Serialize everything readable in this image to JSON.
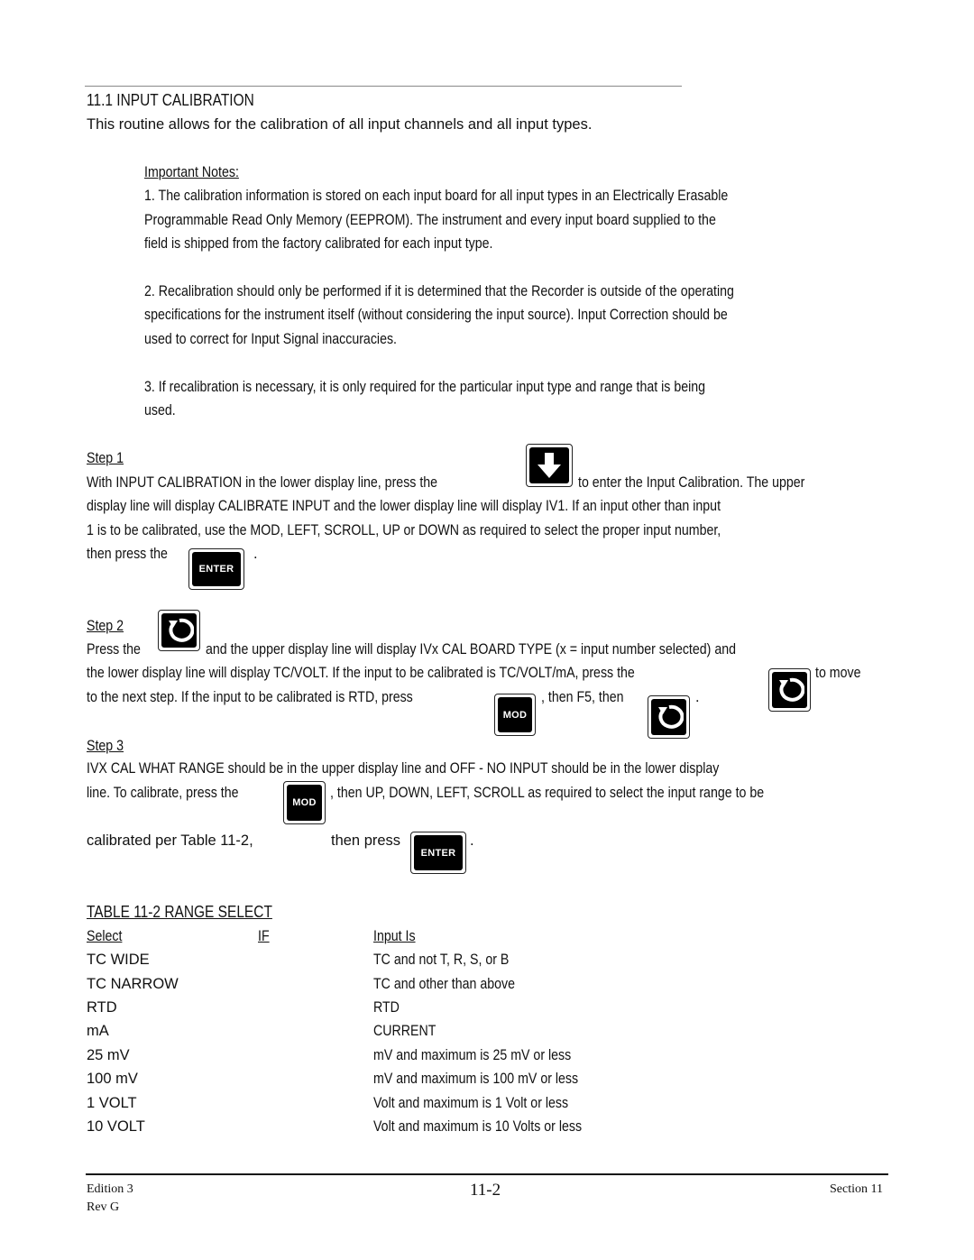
{
  "section": {
    "heading": "11.1  INPUT CALIBRATION",
    "intro": "This routine allows for the calibration of all input channels and all input types."
  },
  "notes": {
    "title": "Important Notes: ",
    "note1": [
      "1.  The calibration information is stored on each input board for all input types in an Electrically Erasable",
      "Programmable Read Only Memory (EEPROM).  The instrument and every input board supplied to the",
      "field is shipped from the factory calibrated for each input type."
    ],
    "note2": [
      "2.  Recalibration should only be performed if it is determined that the Recorder is outside of the operating",
      "specifications for the instrument itself (without considering the input source).  Input Correction should be",
      "used to correct for Input Signal inaccuracies."
    ],
    "note3": [
      "3.  If recalibration is necessary, it is only required for the particular input type and range that is being",
      "used."
    ]
  },
  "step1": {
    "title": "Step 1",
    "line1_before": "With INPUT CALIBRATION  in the lower display line, press the",
    "line1_after": "to enter the Input Calibration.  The upper",
    "line2": "display line will display CALIBRATE INPUT  and the lower display line will display IV1.  If an input other than input",
    "line3": "1 is to be calibrated, use the MOD, LEFT, SCROLL, UP or DOWN as required to select the proper input number,",
    "line4_before": "then press the",
    "line4_after": "."
  },
  "step2": {
    "title": "Step 2",
    "line1_before": "Press the",
    "line1_after": "and the upper display line will display IVx CAL BOARD TYPE  (x = input number selected) and",
    "line2_before": "the lower display line will display TC/VOLT.  If the input to be calibrated is TC/VOLT/mA, press the",
    "line2_after": "to move",
    "line3_before": "to the next step.  If the input to be calibrated is RTD, press",
    "line3_mid": ", then F5, then",
    "line3_after": "."
  },
  "step3": {
    "title": "Step 3",
    "line1": "IVX CAL WHAT RANGE  should be in the upper display line and OFF - NO INPUT should be in the lower display",
    "line2_before": "line.  To calibrate, press the",
    "line2_after": ", then UP, DOWN, LEFT, SCROLL as required to select the input range to be",
    "line3_a": "calibrated  per  Table  11-2,",
    "line3_b": "then press",
    "line3_after": "."
  },
  "keys": {
    "enter": "ENTER",
    "mod": "MOD",
    "down_icon": "down-arrow-icon",
    "scroll_icon": "scroll-cycle-icon"
  },
  "table": {
    "title": "TABLE 11-2  RANGE SELECT",
    "headers": [
      "Select",
      "IF",
      "Input Is"
    ],
    "rows": [
      [
        "TC WIDE",
        "",
        "TC and not T, R, S, or B"
      ],
      [
        "TC NARROW",
        "",
        "TC and other than above"
      ],
      [
        "RTD",
        "",
        "RTD"
      ],
      [
        "mA",
        "",
        "CURRENT"
      ],
      [
        "25 mV",
        "",
        "mV and maximum is 25 mV or less"
      ],
      [
        "100 mV",
        "",
        "mV and maximum is 100 mV or less"
      ],
      [
        "1 VOLT",
        "",
        "Volt and maximum is 1 Volt or less"
      ],
      [
        "10 VOLT",
        "",
        "Volt and maximum is 10 Volts or less"
      ]
    ]
  },
  "footer": {
    "edition": "Edition 3",
    "rev": "Rev G",
    "page": "11-2",
    "section": "Section 11"
  }
}
